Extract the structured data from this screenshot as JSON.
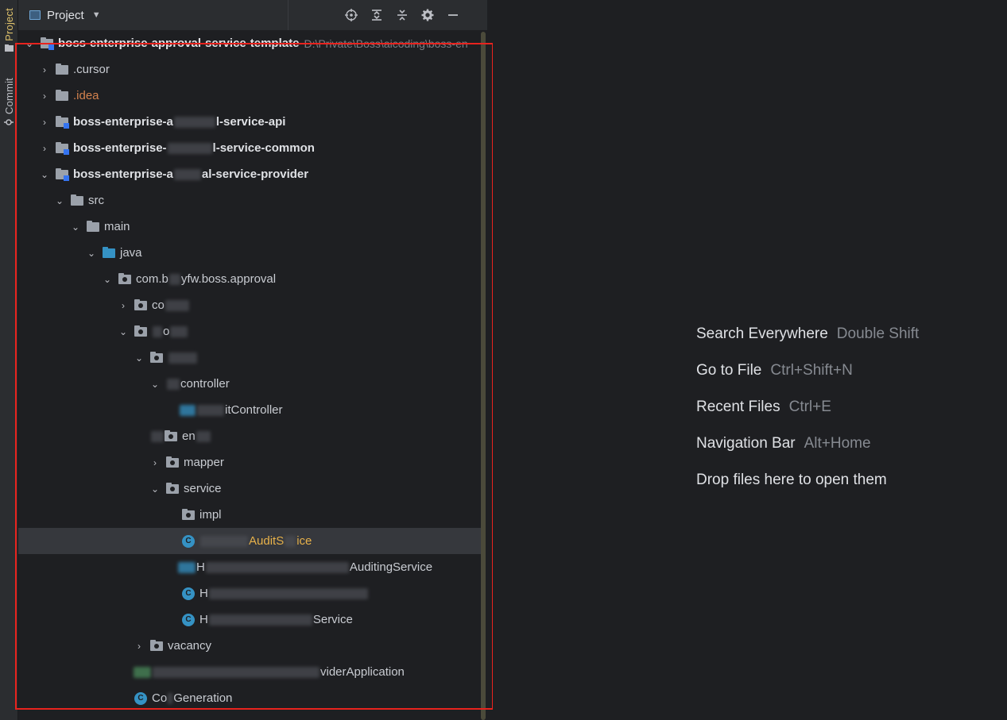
{
  "side_strip": {
    "project_tab": "Project",
    "commit_tab": "Commit"
  },
  "panel": {
    "title": "Project",
    "tools": [
      "locate-icon",
      "expand-all-icon",
      "collapse-all-icon",
      "gear-icon",
      "minimize-icon"
    ]
  },
  "tree": {
    "root_label": "boss-enterprise-approval-service-template",
    "root_path": "D:\\Private\\Boss\\aicoding\\boss-en",
    "cursor": ".cursor",
    "idea": ".idea",
    "module_api": [
      "boss-enterprise-a",
      "l-service-api"
    ],
    "module_common": [
      "boss-enterprise-",
      "l-service-common"
    ],
    "module_provider": [
      "boss-enterprise-a",
      "al-service-provider"
    ],
    "src": "src",
    "main": "main",
    "java": "java",
    "pkg_root": [
      "com.b",
      "yfw.boss.approval"
    ],
    "pkg_1": "co",
    "pkg_2": "o",
    "controller": "controller",
    "controller_class": "itController",
    "pkg_en": "en",
    "mapper": "mapper",
    "service": "service",
    "impl": "impl",
    "selected_class": [
      "AuditS",
      "ice"
    ],
    "class_2": [
      "H",
      "AuditingService"
    ],
    "class_3": "H",
    "class_4": [
      "H",
      "Service"
    ],
    "vacancy": "vacancy",
    "app_class": "viderApplication",
    "codegen": [
      "Co",
      "Generation"
    ]
  },
  "editor_hints": [
    {
      "label": "Search Everywhere",
      "keys": "Double Shift"
    },
    {
      "label": "Go to File",
      "keys": "Ctrl+Shift+N"
    },
    {
      "label": "Recent Files",
      "keys": "Ctrl+E"
    },
    {
      "label": "Navigation Bar",
      "keys": "Alt+Home"
    },
    {
      "label": "Drop files here to open them",
      "keys": ""
    }
  ],
  "colors": {
    "highlight_box": "#e8231e",
    "selected_text": "#e8b24a",
    "excluded_text": "#d4824e"
  }
}
